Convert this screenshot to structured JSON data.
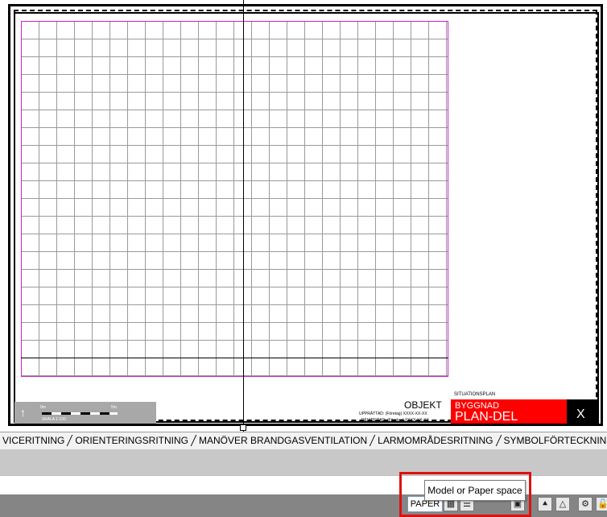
{
  "drawing": {
    "scale_start": "0m",
    "scale_end": "5m",
    "scale_label": "SKALA 1:100",
    "north_symbol": "↑",
    "situationsplan": "SITUATIONSPLAN",
    "objekt": "OBJEKT",
    "upprattad": "UPPRÄTTAD: (Företag) XXXX-XX-XX",
    "reviderad": "REVIDERAD: (Företag) XXXX-XX-XX",
    "byggnad": "BYGGNAD",
    "plan_del": "PLAN-DEL",
    "sheet_x": "X",
    "colors": {
      "grid_border": "#d020d0",
      "title_red": "#ff0000"
    }
  },
  "layout_tabs": [
    "VICERITNING",
    "ORIENTERINGSRITNING",
    "MANÖVER BRANDGASVENTILATION",
    "LARMOMRÅDESRITNING",
    "SYMBOLFÖRTECKNING SR-TUL"
  ],
  "status_bar": {
    "space_button": "PAPER",
    "tooltip": "Model or Paper space",
    "icons": [
      "layout-grid-icon",
      "lineweight-icon",
      "viewport-icon",
      "annotation-scale-icon",
      "workspace-icon",
      "settings-gear-icon",
      "lock-icon"
    ]
  }
}
